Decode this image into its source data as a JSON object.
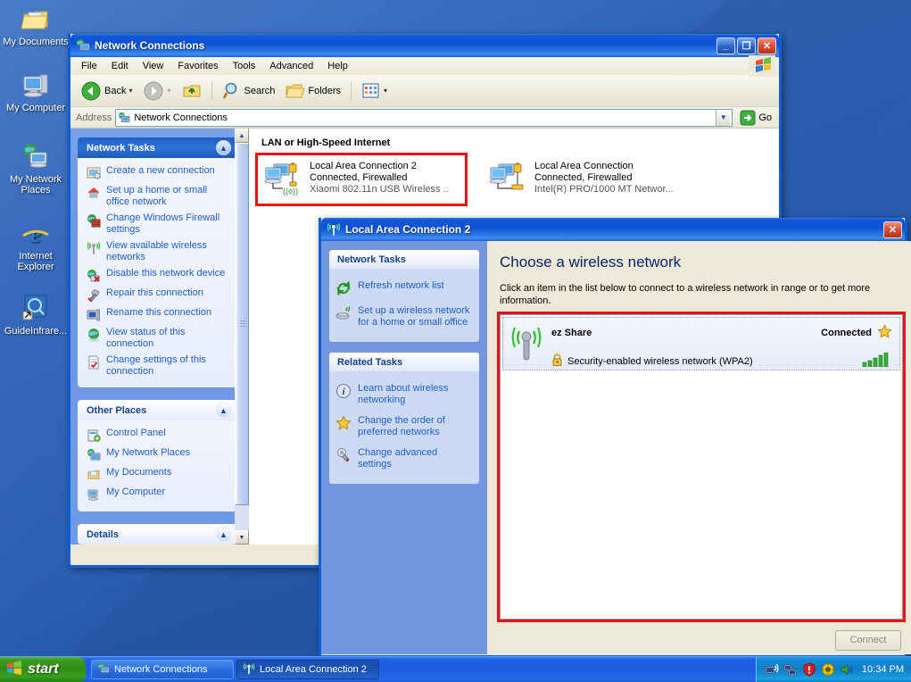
{
  "desktop": {
    "icons": [
      {
        "label": "My Documents",
        "icon": "my-documents-icon"
      },
      {
        "label": "My Computer",
        "icon": "my-computer-icon"
      },
      {
        "label": "My Network Places",
        "icon": "my-network-places-icon"
      },
      {
        "label": "Internet Explorer",
        "icon": "internet-explorer-icon"
      },
      {
        "label": "GuideInfrare...",
        "icon": "guide-infrared-shortcut-icon"
      }
    ]
  },
  "explorer": {
    "title": "Network Connections",
    "title_icon": "network-connections-icon",
    "window_buttons": {
      "minimize": "_",
      "maximize": "❐",
      "close": "✕"
    },
    "menus": [
      "File",
      "Edit",
      "View",
      "Favorites",
      "Tools",
      "Advanced",
      "Help"
    ],
    "toolbar": {
      "back": "Back",
      "forward": "",
      "up": "",
      "search": "Search",
      "folders": "Folders",
      "views": ""
    },
    "address": {
      "label": "Address",
      "value": "Network Connections",
      "go": "Go"
    },
    "network_tasks": {
      "header": "Network Tasks",
      "items": [
        {
          "label": "Create a new connection",
          "icon": "new-connection-icon"
        },
        {
          "label": "Set up a home or small office network",
          "icon": "home-network-icon"
        },
        {
          "label": "Change Windows Firewall settings",
          "icon": "firewall-icon"
        },
        {
          "label": "View available wireless networks",
          "icon": "wireless-signal-icon"
        },
        {
          "label": "Disable this network device",
          "icon": "disable-device-icon"
        },
        {
          "label": "Repair this connection",
          "icon": "repair-wrench-icon"
        },
        {
          "label": "Rename this connection",
          "icon": "rename-icon"
        },
        {
          "label": "View status of this connection",
          "icon": "status-globe-icon"
        },
        {
          "label": "Change settings of this connection",
          "icon": "settings-page-icon"
        }
      ]
    },
    "other_places": {
      "header": "Other Places",
      "items": [
        {
          "label": "Control Panel",
          "icon": "control-panel-icon"
        },
        {
          "label": "My Network Places",
          "icon": "my-network-places-icon"
        },
        {
          "label": "My Documents",
          "icon": "my-documents-icon"
        },
        {
          "label": "My Computer",
          "icon": "my-computer-icon"
        }
      ]
    },
    "details": {
      "header": "Details"
    },
    "content": {
      "group_header": "LAN or High-Speed Internet",
      "connections": [
        {
          "name": "Local Area Connection 2",
          "status": "Connected, Firewalled",
          "device": "Xiaomi 802.11n USB Wireless ..",
          "highlighted": true
        },
        {
          "name": "Local Area Connection",
          "status": "Connected, Firewalled",
          "device": "Intel(R) PRO/1000 MT Networ...",
          "highlighted": false
        }
      ]
    }
  },
  "wireless_dialog": {
    "title": "Local Area Connection 2",
    "title_icon": "wireless-signal-icon",
    "close_label": "✕",
    "heading": "Choose a wireless network",
    "instruction": "Click an item in the list below to connect to a wireless network in range or to get more information.",
    "network_tasks": {
      "header": "Network Tasks",
      "items": [
        {
          "label": "Refresh network list",
          "icon": "refresh-icon"
        },
        {
          "label": "Set up a wireless network for a home or small office",
          "icon": "wireless-setup-icon"
        }
      ]
    },
    "related_tasks": {
      "header": "Related Tasks",
      "items": [
        {
          "label": "Learn about wireless networking",
          "icon": "info-icon"
        },
        {
          "label": "Change the order of preferred networks",
          "icon": "star-icon"
        },
        {
          "label": "Change advanced settings",
          "icon": "advanced-settings-icon"
        }
      ]
    },
    "networks": [
      {
        "ssid": "ez Share",
        "state": "Connected",
        "security": "Security-enabled wireless network (WPA2)",
        "signal_bars": 5,
        "preferred": true,
        "highlighted": true
      }
    ],
    "connect_button": "Connect"
  },
  "taskbar": {
    "start_label": "start",
    "tasks": [
      {
        "label": "Network Connections",
        "icon": "network-connections-icon",
        "active": false
      },
      {
        "label": "Local Area Connection 2",
        "icon": "wireless-signal-icon",
        "active": true
      }
    ],
    "tray_icons": [
      "wireless-network-tray-icon",
      "network-tray-icon",
      "security-alert-tray-icon",
      "update-tray-icon",
      "volume-tray-icon"
    ],
    "clock": "10:34 PM"
  },
  "colors": {
    "accent_blue": "#0a5fd4",
    "highlight_red": "#ee1111",
    "link_blue": "#215dc6",
    "desktop_blue": "#2a5fb4"
  }
}
